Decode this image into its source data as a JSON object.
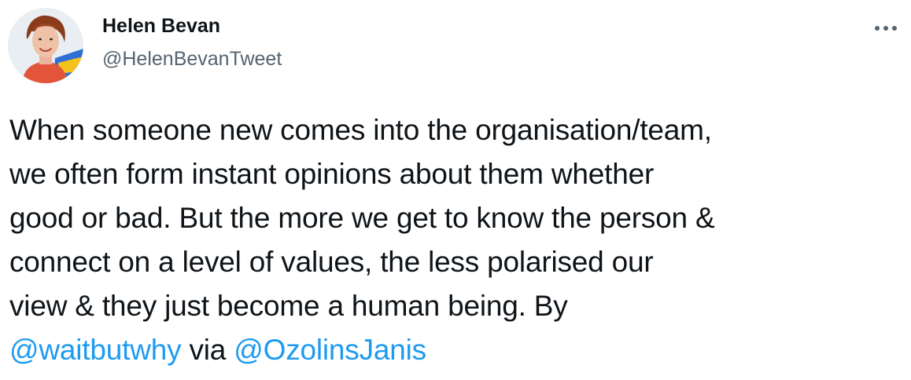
{
  "author": {
    "display_name": "Helen Bevan",
    "handle": "@HelenBevanTweet",
    "avatar_icon": "profile-photo-icon"
  },
  "menu": {
    "more_icon": "more-options-icon"
  },
  "tweet": {
    "lines": [
      "When someone new comes into the organisation/team,",
      "we often form instant opinions about them whether",
      "good or bad. But the more we get to know the person &",
      "connect on a level of values, the less polarised our",
      "view & they just become a human being. By"
    ],
    "mention_1": "@waitbutwhy",
    "via": " via ",
    "mention_2": "@OzolinsJanis"
  },
  "colors": {
    "text": "#0f1419",
    "secondary_text": "#536471",
    "link": "#1d9bf0",
    "background": "#ffffff"
  }
}
